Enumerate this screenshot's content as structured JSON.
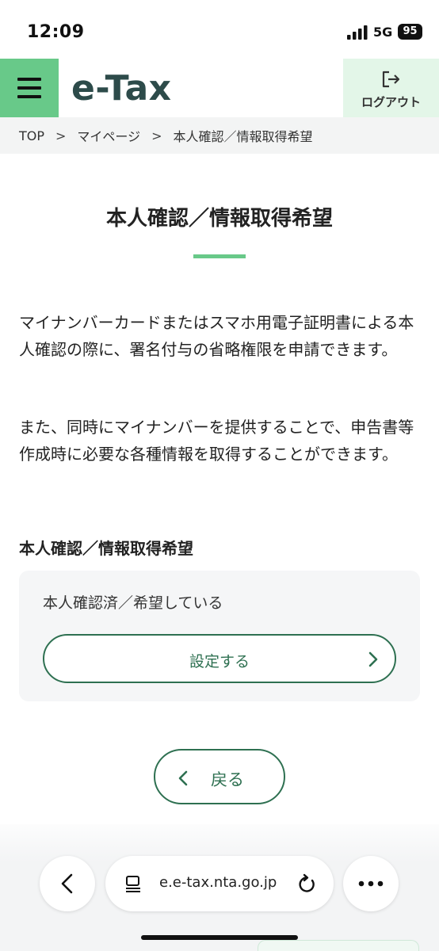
{
  "status_bar": {
    "time": "12:09",
    "network": "5G",
    "battery": "95"
  },
  "header": {
    "menu_icon": "hamburger-menu-icon",
    "logo": "e-Tax",
    "logout_label": "ログアウト",
    "logout_icon": "logout-icon"
  },
  "breadcrumb": {
    "items": [
      "TOP",
      "マイページ",
      "本人確認／情報取得希望"
    ],
    "separator": ">"
  },
  "main": {
    "title": "本人確認／情報取得希望",
    "paragraphs": [
      "マイナンバーカードまたはスマホ用電子証明書による本人確認の際に、署名付与の省略権限を申請できます。",
      "また、同時にマイナンバーを提供することで、申告書等作成時に必要な各種情報を取得することができます。"
    ],
    "section_heading": "本人確認／情報取得希望",
    "status_text": "本人確認済／希望している",
    "settings_button_label": "設定する",
    "back_button_label": "戻る"
  },
  "browser": {
    "url": "e.e-tax.nta.go.jp",
    "back_icon": "chevron-left-icon",
    "reader_icon": "reader-icon",
    "reload_icon": "reload-icon",
    "more_icon": "ellipsis-icon"
  },
  "colors": {
    "brand_green": "#68c989",
    "accent_dark_green": "#2e7051",
    "logo_color": "#2d4b4a",
    "logout_bg": "#e3f6e8"
  }
}
